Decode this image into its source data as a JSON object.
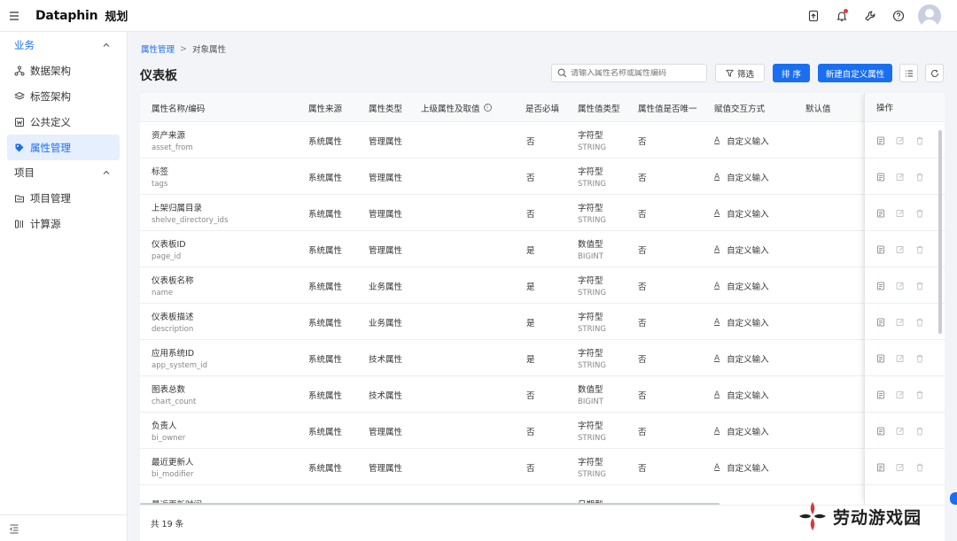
{
  "app": {
    "brand": "Dataphin",
    "module": "规划"
  },
  "sidebar": {
    "groups": [
      {
        "label": "业务",
        "items": [
          {
            "label": "数据架构",
            "icon": "hierarchy-icon"
          },
          {
            "label": "标签架构",
            "icon": "layers-icon"
          },
          {
            "label": "公共定义",
            "icon": "doc-w-icon"
          },
          {
            "label": "属性管理",
            "icon": "tag-icon",
            "active": true
          }
        ]
      },
      {
        "label": "项目",
        "items": [
          {
            "label": "项目管理",
            "icon": "folder-icon"
          },
          {
            "label": "计算源",
            "icon": "compute-icon"
          }
        ]
      }
    ]
  },
  "breadcrumb": {
    "parent": "属性管理",
    "separator": ">",
    "current": "对象属性"
  },
  "page_title": "仪表板",
  "toolbar": {
    "search_placeholder": "请输入属性名称或属性编码",
    "filter_label": "筛选",
    "sort_label": "排 序",
    "new_label": "新建自定义属性"
  },
  "table": {
    "columns": [
      "属性名称/编码",
      "属性来源",
      "属性类型",
      "上级属性及取值",
      "是否必填",
      "属性值类型",
      "属性值是否唯一",
      "赋值交互方式",
      "默认值",
      "操作"
    ],
    "rows": [
      {
        "name": "资产来源",
        "code": "asset_from",
        "source": "系统属性",
        "type": "管理属性",
        "parent": "",
        "required": "否",
        "vtype": "字符型",
        "vcode": "STRING",
        "unique": "否",
        "interaction": "自定义输入",
        "default": ""
      },
      {
        "name": "标签",
        "code": "tags",
        "source": "系统属性",
        "type": "管理属性",
        "parent": "",
        "required": "否",
        "vtype": "字符型",
        "vcode": "STRING",
        "unique": "否",
        "interaction": "自定义输入",
        "default": ""
      },
      {
        "name": "上架归属目录",
        "code": "shelve_directory_ids",
        "source": "系统属性",
        "type": "管理属性",
        "parent": "",
        "required": "否",
        "vtype": "字符型",
        "vcode": "STRING",
        "unique": "否",
        "interaction": "自定义输入",
        "default": ""
      },
      {
        "name": "仪表板ID",
        "code": "page_id",
        "source": "系统属性",
        "type": "管理属性",
        "parent": "",
        "required": "是",
        "vtype": "数值型",
        "vcode": "BIGINT",
        "unique": "否",
        "interaction": "自定义输入",
        "default": ""
      },
      {
        "name": "仪表板名称",
        "code": "name",
        "source": "系统属性",
        "type": "业务属性",
        "parent": "",
        "required": "是",
        "vtype": "字符型",
        "vcode": "STRING",
        "unique": "否",
        "interaction": "自定义输入",
        "default": ""
      },
      {
        "name": "仪表板描述",
        "code": "description",
        "source": "系统属性",
        "type": "业务属性",
        "parent": "",
        "required": "是",
        "vtype": "字符型",
        "vcode": "STRING",
        "unique": "否",
        "interaction": "自定义输入",
        "default": ""
      },
      {
        "name": "应用系统ID",
        "code": "app_system_id",
        "source": "系统属性",
        "type": "技术属性",
        "parent": "",
        "required": "是",
        "vtype": "字符型",
        "vcode": "STRING",
        "unique": "否",
        "interaction": "自定义输入",
        "default": ""
      },
      {
        "name": "图表总数",
        "code": "chart_count",
        "source": "系统属性",
        "type": "技术属性",
        "parent": "",
        "required": "否",
        "vtype": "数值型",
        "vcode": "BIGINT",
        "unique": "否",
        "interaction": "自定义输入",
        "default": ""
      },
      {
        "name": "负责人",
        "code": "bi_owner",
        "source": "系统属性",
        "type": "管理属性",
        "parent": "",
        "required": "否",
        "vtype": "字符型",
        "vcode": "STRING",
        "unique": "否",
        "interaction": "自定义输入",
        "default": ""
      },
      {
        "name": "最近更新人",
        "code": "bi_modifier",
        "source": "系统属性",
        "type": "管理属性",
        "parent": "",
        "required": "否",
        "vtype": "字符型",
        "vcode": "STRING",
        "unique": "否",
        "interaction": "自定义输入",
        "default": ""
      },
      {
        "name": "最近更新时间",
        "code": "",
        "source": "",
        "type": "",
        "parent": "",
        "required": "",
        "vtype": "日期型",
        "vcode": "",
        "unique": "",
        "interaction": "",
        "default": ""
      }
    ]
  },
  "footer": {
    "total": "共 19 条"
  },
  "watermark": {
    "text": "劳动游戏园"
  },
  "colors": {
    "primary": "#1a6ff0",
    "active_bg": "#e6effd",
    "notification": "#e23b3b"
  }
}
